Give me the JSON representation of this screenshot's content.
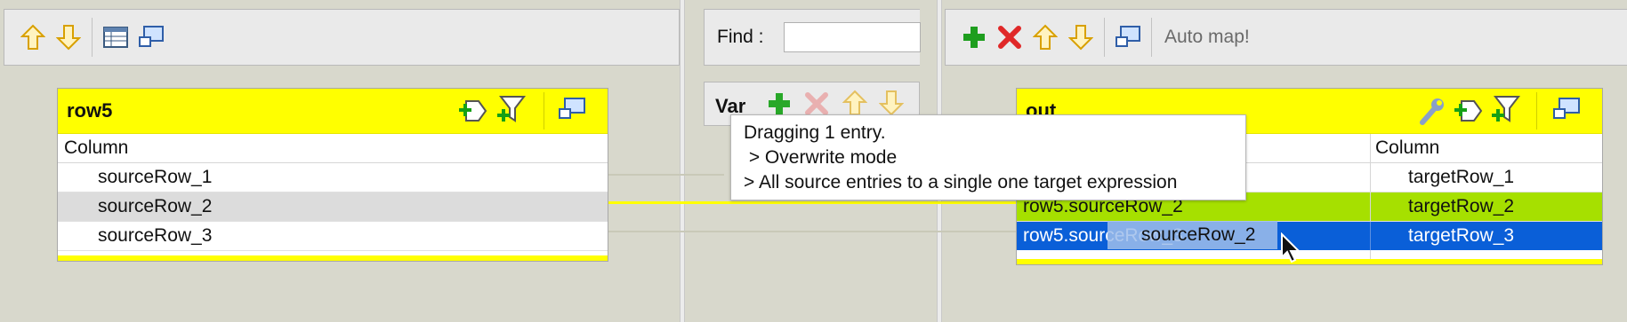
{
  "left_toolbar": {
    "icons": [
      "up-arrow-icon",
      "down-arrow-icon",
      "table-icon",
      "minimize-icon"
    ]
  },
  "find": {
    "label": "Find :",
    "value": ""
  },
  "var_panel": {
    "title": "Var",
    "icons": [
      "add-icon",
      "delete-icon",
      "up-arrow-icon",
      "down-arrow-icon"
    ]
  },
  "right_toolbar": {
    "icons": [
      "add-icon",
      "delete-icon",
      "up-arrow-icon",
      "down-arrow-icon",
      "minimize-icon"
    ],
    "automap_label": "Auto map!"
  },
  "input_table": {
    "title": "row5",
    "column_header": "Column",
    "rows": [
      "sourceRow_1",
      "sourceRow_2",
      "sourceRow_3"
    ]
  },
  "output_table": {
    "title": "out",
    "expression_header": "",
    "column_header": "Column",
    "rows": [
      {
        "expression": "",
        "column": "targetRow_1"
      },
      {
        "expression": "row5.sourceRow_2",
        "column": "targetRow_2"
      },
      {
        "expression": "row5.sourceRow_3",
        "column": "targetRow_3"
      }
    ]
  },
  "tooltip": {
    "line1": "Dragging 1 entry.",
    "line2": " > Overwrite mode",
    "line3": "> All source entries to a single one target expression"
  },
  "drag_ghost": {
    "label": "sourceRow_2"
  },
  "colors": {
    "header_yellow": "#ffff00",
    "selected_blue": "#0a5fd8",
    "mapped_green": "#a6e000",
    "panel_bg": "#d8d8cc"
  }
}
